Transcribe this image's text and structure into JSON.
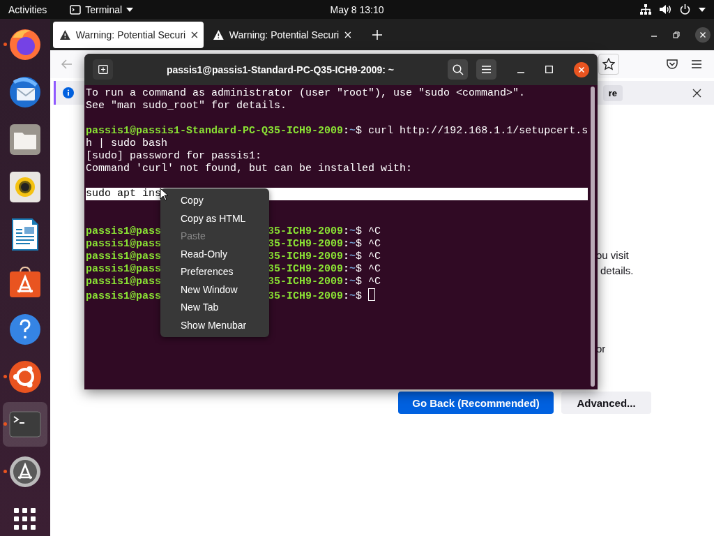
{
  "top_bar": {
    "activities": "Activities",
    "app_menu": "Terminal",
    "clock": "May 8  13:10"
  },
  "dock": {
    "items": [
      {
        "kind": "firefox",
        "running": true,
        "active": false
      },
      {
        "kind": "thunderbird",
        "running": false,
        "active": false
      },
      {
        "kind": "files",
        "running": false,
        "active": false
      },
      {
        "kind": "rhythmbox",
        "running": false,
        "active": false
      },
      {
        "kind": "writer",
        "running": false,
        "active": false
      },
      {
        "kind": "software",
        "running": false,
        "active": false
      },
      {
        "kind": "help",
        "running": false,
        "active": false
      },
      {
        "kind": "ubuntu",
        "running": true,
        "active": false
      },
      {
        "kind": "terminal",
        "running": true,
        "active": true
      },
      {
        "kind": "updater",
        "running": true,
        "active": false
      },
      {
        "kind": "apps",
        "running": false,
        "active": false
      }
    ]
  },
  "browser": {
    "tabs": [
      {
        "title": "Warning: Potential Securi",
        "selected": true
      },
      {
        "title": "Warning: Potential Securi",
        "selected": false
      }
    ],
    "notification": {
      "button": "re"
    },
    "page": {
      "paragraphs": [
        [
          "ou visit",
          "details."
        ],
        [
          "or"
        ]
      ],
      "buttons": [
        {
          "label": "Go Back (Recommended)",
          "kind": "primary"
        },
        {
          "label": "Advanced...",
          "kind": "secondary"
        }
      ]
    }
  },
  "terminal": {
    "title": "passis1@passis1-Standard-PC-Q35-ICH9-2009: ~",
    "lines": [
      {
        "kind": "output",
        "text": "To run a command as administrator (user \"root\"), use \"sudo <command>\".",
        "selected": false
      },
      {
        "kind": "output",
        "text": "See \"man sudo_root\" for details.",
        "selected": false
      },
      {
        "kind": "blank"
      },
      {
        "kind": "prompt",
        "user_host": "passis1@passis1-Standard-PC-Q35-ICH9-2009",
        "separator": ":",
        "path": "~",
        "symbol": "$",
        "command": "curl http://192.168.1.1/setupcert.s",
        "cursor": false
      },
      {
        "kind": "output",
        "text": "h | sudo bash",
        "selected": false
      },
      {
        "kind": "output",
        "text": "[sudo] password for passis1:",
        "selected": false
      },
      {
        "kind": "output",
        "text": "Command 'curl' not found, but can be installed with:",
        "selected": false
      },
      {
        "kind": "blank"
      },
      {
        "kind": "output",
        "text": "sudo apt ins",
        "selected": true
      },
      {
        "kind": "blank"
      },
      {
        "kind": "blank"
      },
      {
        "kind": "prompt",
        "user_host": "passis1@pass",
        "user_host_after": "35-ICH9-2009",
        "separator": ":",
        "path": "~",
        "symbol": "$",
        "command": "^C",
        "cursor": false
      },
      {
        "kind": "prompt",
        "user_host": "passis1@pass",
        "user_host_after": "35-ICH9-2009",
        "separator": ":",
        "path": "~",
        "symbol": "$",
        "command": "^C",
        "cursor": false
      },
      {
        "kind": "prompt",
        "user_host": "passis1@pass",
        "user_host_after": "35-ICH9-2009",
        "separator": ":",
        "path": "~",
        "symbol": "$",
        "command": "^C",
        "cursor": false
      },
      {
        "kind": "prompt",
        "user_host": "passis1@pass",
        "user_host_after": "35-ICH9-2009",
        "separator": ":",
        "path": "~",
        "symbol": "$",
        "command": "^C",
        "cursor": false
      },
      {
        "kind": "prompt",
        "user_host": "passis1@pass",
        "user_host_after": "35-ICH9-2009",
        "separator": ":",
        "path": "~",
        "symbol": "$",
        "command": "^C",
        "cursor": false
      },
      {
        "kind": "prompt",
        "user_host": "passis1@pass",
        "user_host_after": "35-ICH9-2009",
        "separator": ":",
        "path": "~",
        "symbol": "$",
        "cursor": true
      }
    ]
  },
  "context_menu": {
    "items": [
      {
        "label": "Copy",
        "disabled": false
      },
      {
        "label": "Copy as HTML",
        "disabled": false
      },
      {
        "label": "Paste",
        "disabled": true
      },
      {
        "label": "Read-Only",
        "disabled": false
      },
      {
        "label": "Preferences",
        "disabled": false
      },
      {
        "label": "New Window",
        "disabled": false
      },
      {
        "label": "New Tab",
        "disabled": false
      },
      {
        "label": "Show Menubar",
        "disabled": false
      }
    ]
  }
}
